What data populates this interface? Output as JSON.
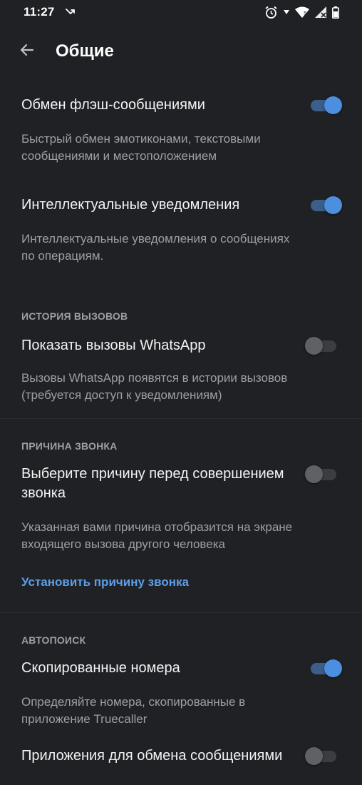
{
  "status_bar": {
    "time": "11:27",
    "icons": [
      "missed-call-icon",
      "alarm-icon",
      "data-arrow-icon",
      "wifi-icon",
      "signal-icon",
      "battery-icon"
    ]
  },
  "app_bar": {
    "title": "Общие",
    "back_icon": "arrow-back-icon"
  },
  "settings": {
    "flash": {
      "title": "Обмен флэш-сообщениями",
      "description": "Быстрый обмен эмотиконами, текстовыми сообщениями и местоположением",
      "enabled": true
    },
    "smart_notifications": {
      "title": "Интеллектуальные уведомления",
      "description": "Интеллектуальные уведомления о сообщениях по операциям.",
      "enabled": true
    },
    "call_history": {
      "header": "ИСТОРИЯ ВЫЗОВОВ",
      "title": "Показать вызовы WhatsApp",
      "description": "Вызовы WhatsApp появятся в истории вызовов (требуется доступ к уведомлениям)",
      "enabled": false
    },
    "call_reason": {
      "header": "ПРИЧИНА ЗВОНКА",
      "title": "Выберите причину перед совершением звонка",
      "description": "Указанная вами причина отобразится на экране входящего вызова другого человека",
      "enabled": false,
      "link": "Установить причину звонка"
    },
    "autosearch": {
      "header": "АВТОПОИСК",
      "copied_numbers": {
        "title": "Скопированные номера",
        "description": "Определяйте номера, скопированные в приложение Truecaller",
        "enabled": true
      },
      "messaging_apps": {
        "title": "Приложения для обмена сообщениями",
        "enabled": false
      }
    }
  },
  "colors": {
    "background": "#202124",
    "accent": "#4c8fe0",
    "link": "#5e9ee8",
    "secondary_text": "#9aa0a6"
  }
}
